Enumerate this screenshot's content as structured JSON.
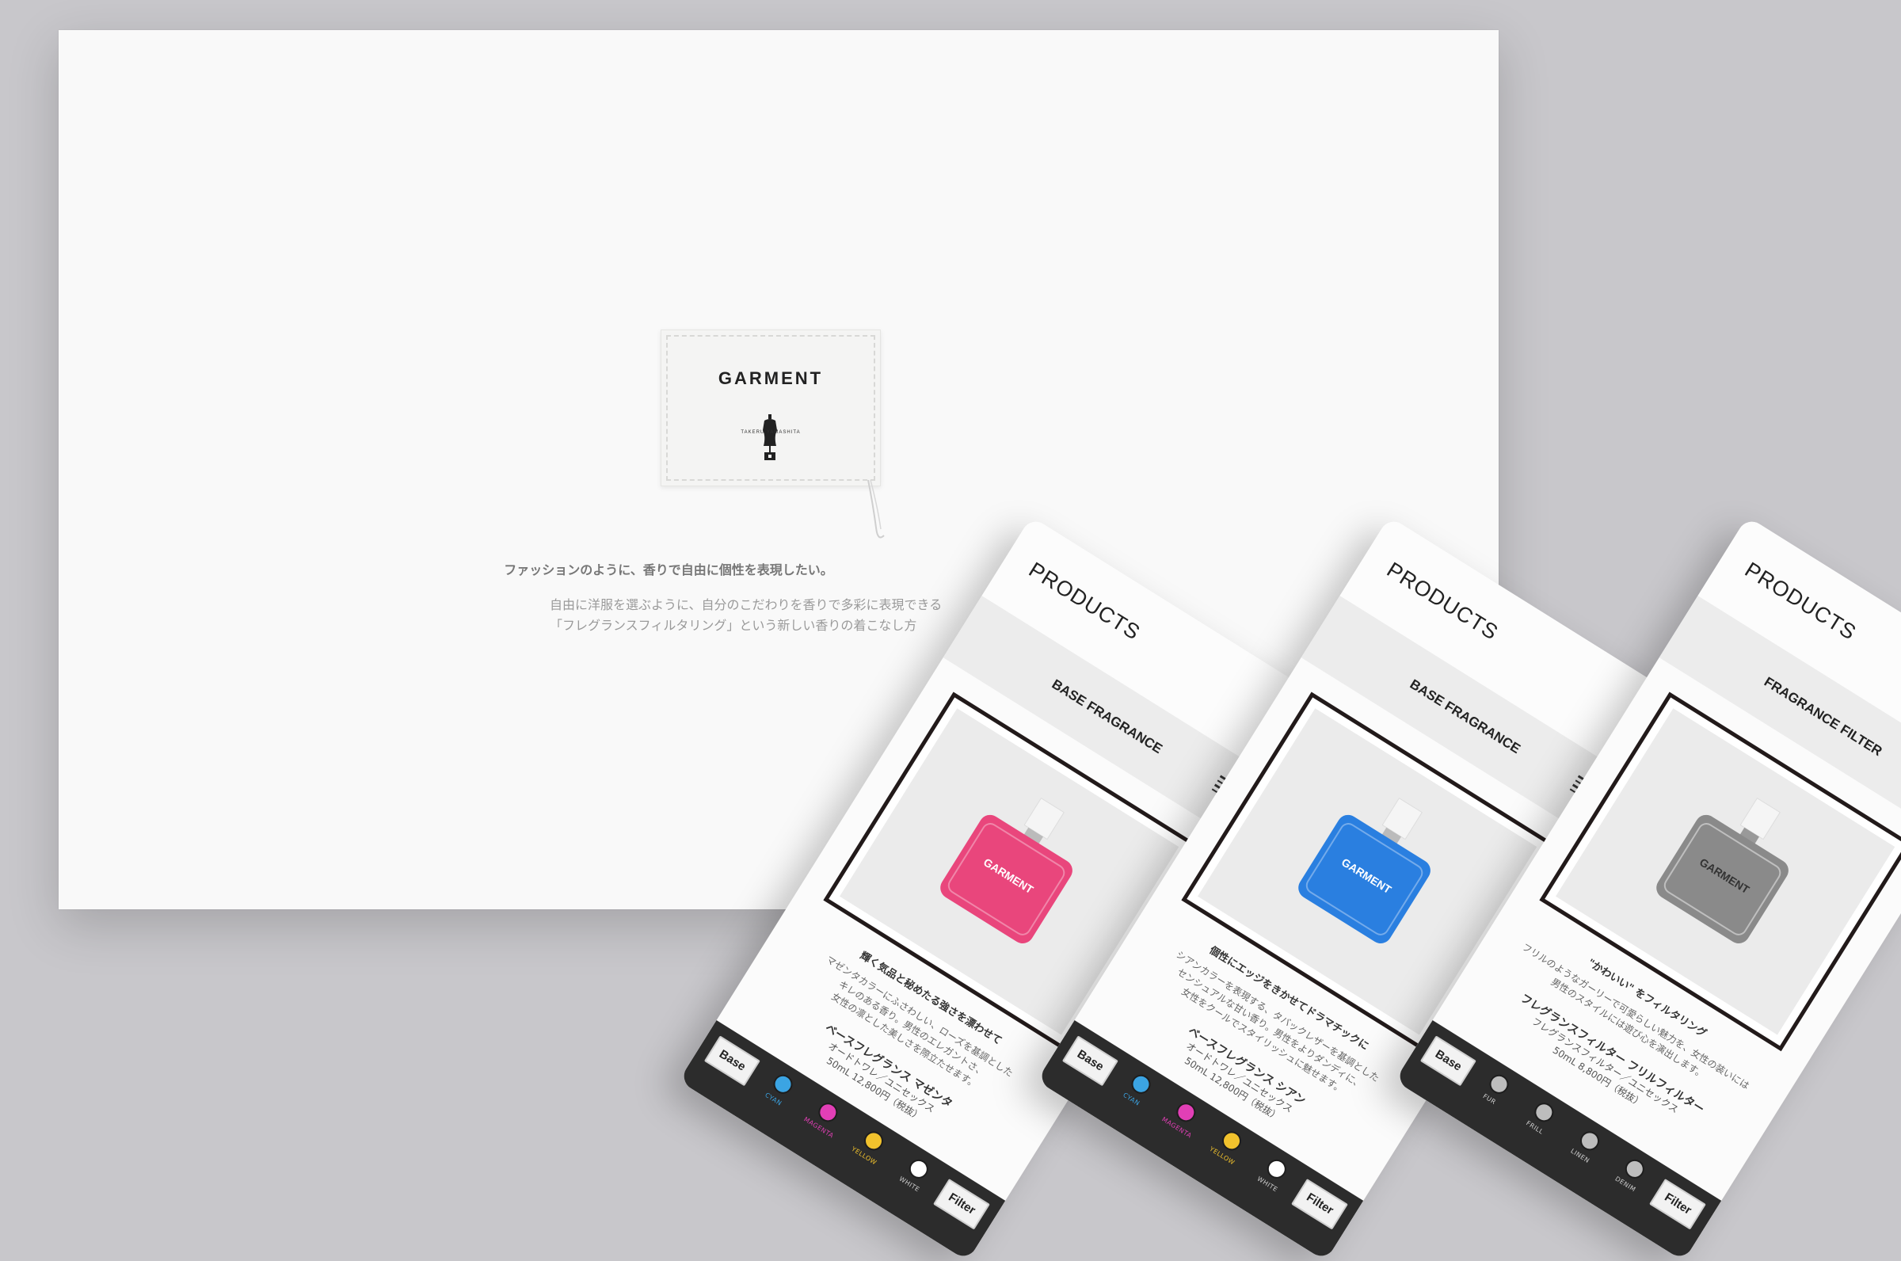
{
  "desktop": {
    "tag": {
      "brand": "GARMENT",
      "sub": "TAKERU YAMASHITA"
    },
    "tagline": "ファッションのように、香りで自由に個性を表現したい。",
    "desc_line1": "自由に洋服を選ぶように、自分のこだわりを香りで多彩に表現できる",
    "desc_line2": "「フレグランスフィルタリング」という新しい香りの着こなし方"
  },
  "phones": [
    {
      "title": "PRODUCTS",
      "subtitle": "BASE FRAGRANCE",
      "bottle_color": "#e9467c",
      "headline": "輝く気品と秘めたる強さを漂わせて",
      "body1": "マゼンタカラーにふさわしい、ローズを基調とした",
      "body2": "キレのある香り。男性のエレガントさ、",
      "body3": "女性の凛とした美しさを際立たせます。",
      "product": "ベースフレグランス マゼンタ",
      "price1": "オードトワレ／ユニセックス",
      "price2": "50mL 12,800円（税抜）",
      "left_button": "Base",
      "right_button": "Filter",
      "swatches": [
        {
          "label": "CYAN",
          "color": "#3ba4e3"
        },
        {
          "label": "MAGENTA",
          "color": "#e23fb6"
        },
        {
          "label": "YELLOW",
          "color": "#f1c22d"
        },
        {
          "label": "WHITE",
          "color": "#ffffff"
        }
      ]
    },
    {
      "title": "PRODUCTS",
      "subtitle": "BASE FRAGRANCE",
      "bottle_color": "#2a7fe0",
      "headline": "個性にエッジをきかせてドラマチックに",
      "body1": "シアンカラーを表現する、タバックレザーを基調とした",
      "body2": "センシュアルな甘い香り。男性をよりダンディに、",
      "body3": "女性をクールでスタイリッシュに魅せます。",
      "product": "ベースフレグランス シアン",
      "price1": "オードトワレ／ユニセックス",
      "price2": "50mL 12,800円（税抜）",
      "left_button": "Base",
      "right_button": "Filter",
      "swatches": [
        {
          "label": "CYAN",
          "color": "#3ba4e3"
        },
        {
          "label": "MAGENTA",
          "color": "#e23fb6"
        },
        {
          "label": "YELLOW",
          "color": "#f1c22d"
        },
        {
          "label": "WHITE",
          "color": "#ffffff"
        }
      ]
    },
    {
      "title": "PRODUCTS",
      "subtitle": "FRAGRANCE FILTER",
      "bottle_color": "#8a8a8a",
      "headline": "\"かわいい\" をフィルタリング",
      "body1": "フリルのようなガーリーで可愛らしい魅力を、女性の装いには",
      "body2": "男性のスタイルには遊び心を演出します。",
      "body3": "",
      "product": "フレグランスフィルター フリルフィルター",
      "price1": "フレグランスフィルター／ユニセックス",
      "price2": "50mL 8,800円（税抜）",
      "left_button": "Base",
      "right_button": "Filter",
      "swatches": [
        {
          "label": "FUR",
          "color": "#bdbdbd"
        },
        {
          "label": "FRILL",
          "color": "#bdbdbd"
        },
        {
          "label": "LINEN",
          "color": "#bdbdbd"
        },
        {
          "label": "DENIM",
          "color": "#bdbdbd"
        }
      ]
    }
  ]
}
